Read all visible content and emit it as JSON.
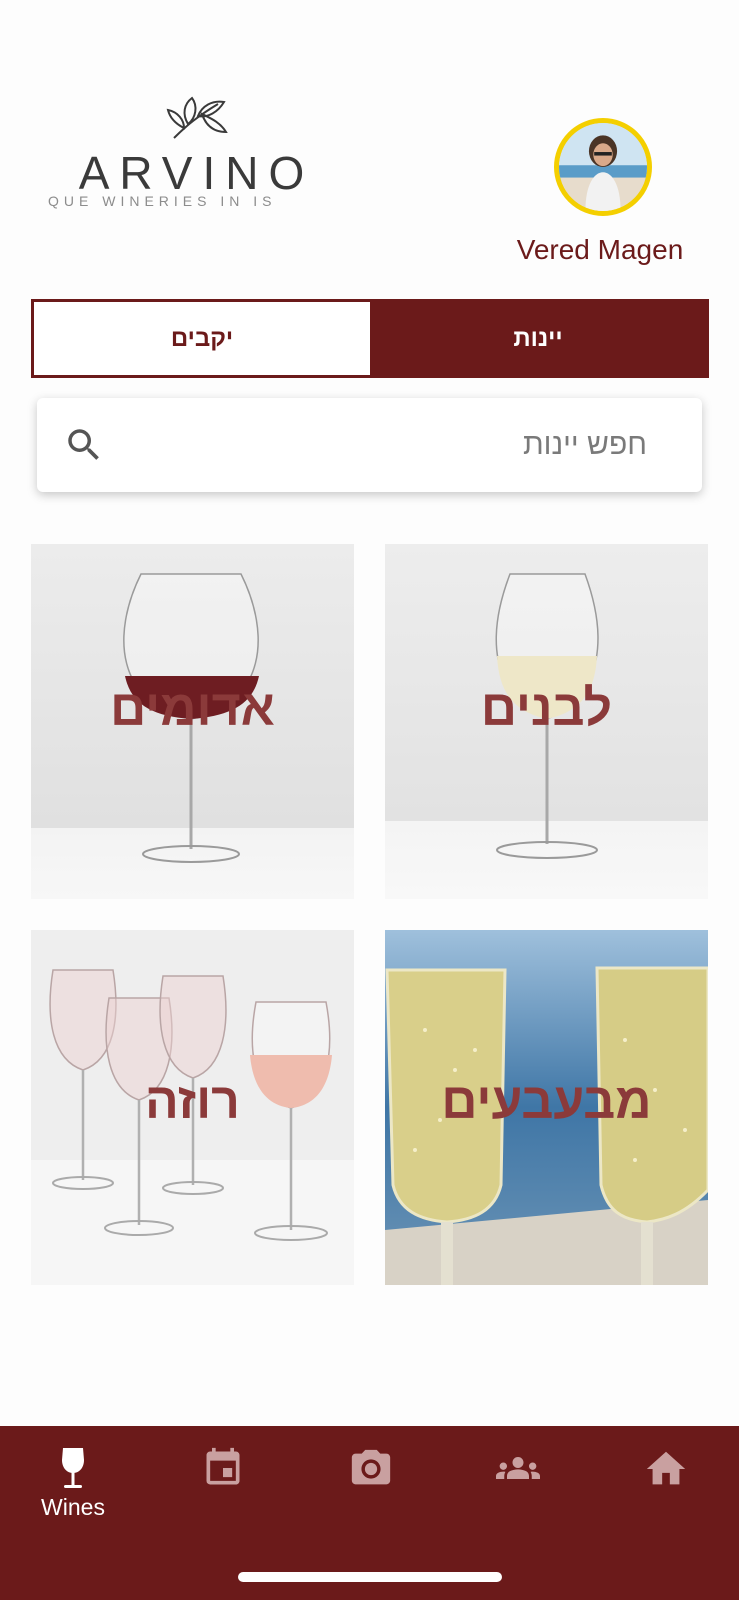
{
  "header": {
    "logo_text": "ARVINO",
    "logo_tagline": "QUE WINERIES IN IS",
    "user_name": "Vered Magen"
  },
  "tabs": [
    {
      "label": "יקבים",
      "active": false
    },
    {
      "label": "יינות",
      "active": true
    }
  ],
  "search": {
    "placeholder": "חפש יינות",
    "icon": "search-icon"
  },
  "categories": [
    {
      "label": "אדומים",
      "image": "red-wine-glass"
    },
    {
      "label": "לבנים",
      "image": "white-wine-glass"
    },
    {
      "label": "רוזה",
      "image": "rose-wine-glasses"
    },
    {
      "label": "מבעבעים",
      "image": "sparkling-wine-glasses"
    }
  ],
  "bottom_nav": {
    "items": [
      {
        "label": "Wines",
        "icon": "wine-glass-icon",
        "active": true
      },
      {
        "label": "",
        "icon": "calendar-icon",
        "active": false
      },
      {
        "label": "",
        "icon": "camera-icon",
        "active": false
      },
      {
        "label": "",
        "icon": "group-icon",
        "active": false
      },
      {
        "label": "",
        "icon": "home-icon",
        "active": false
      }
    ]
  },
  "colors": {
    "primary": "#6b1a1a",
    "avatar_ring": "#f4cf00",
    "category_label": "#8b3a3a",
    "nav_icon_inactive": "#c9a0a0"
  }
}
